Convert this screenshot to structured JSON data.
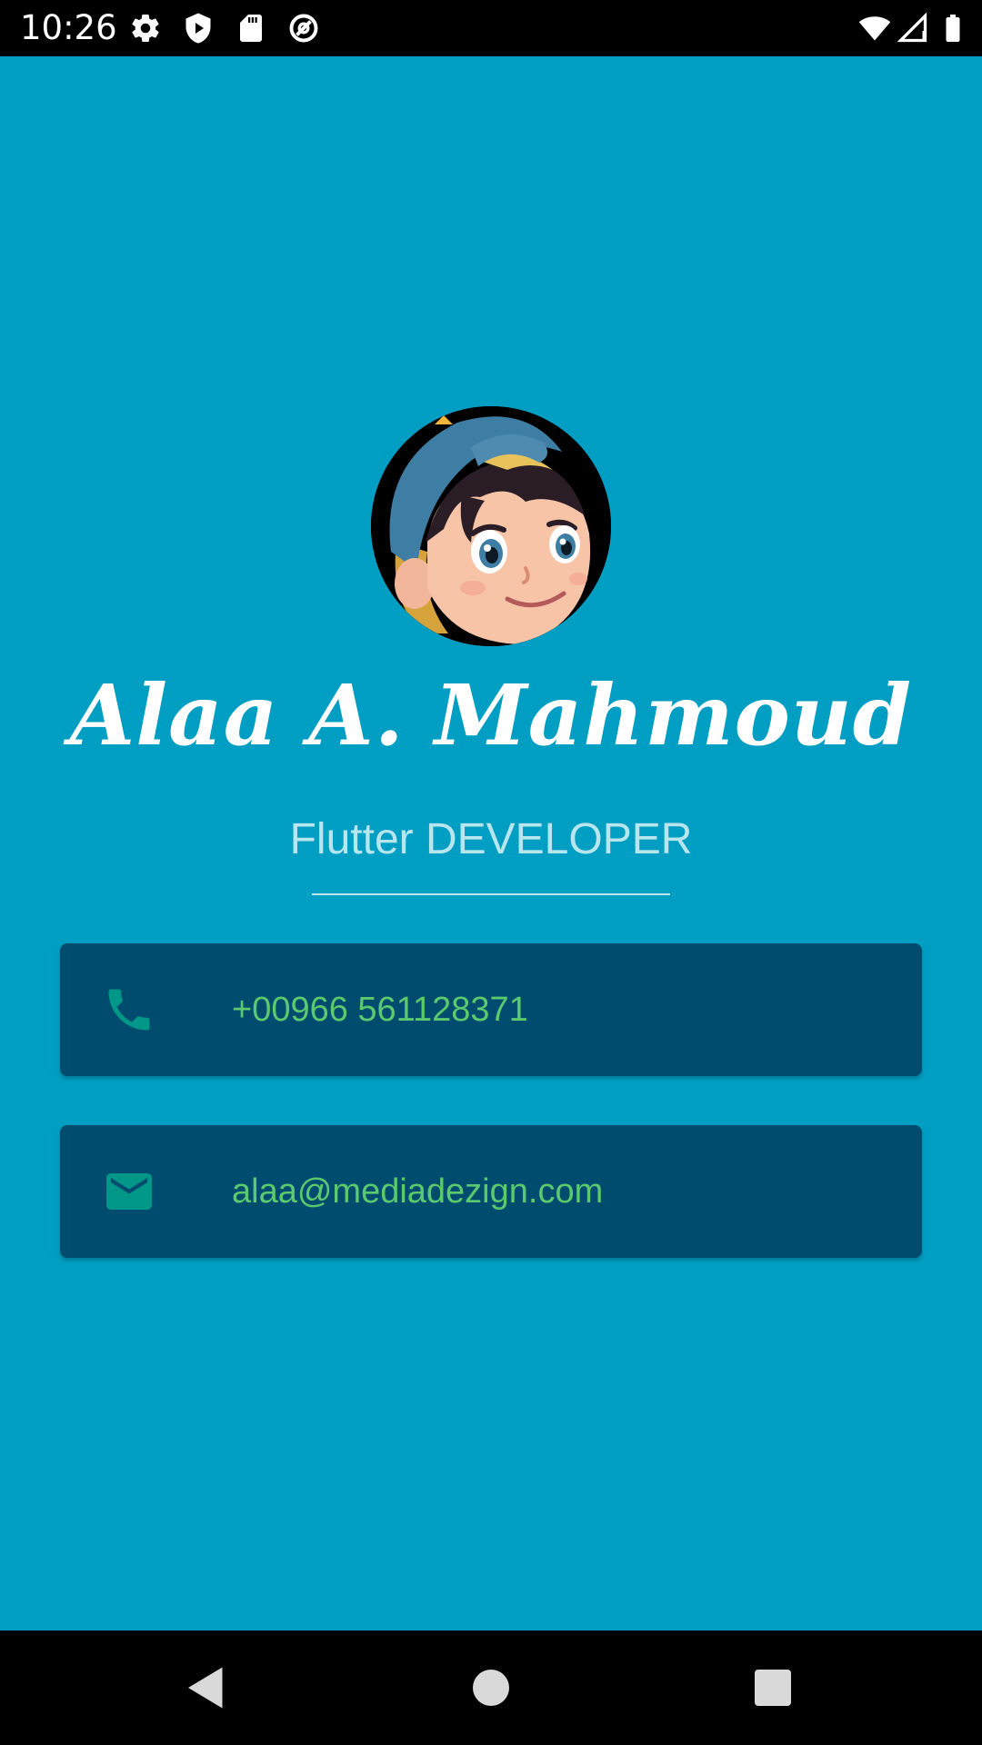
{
  "status_bar": {
    "time": "10:26",
    "icons": [
      "settings-icon",
      "shield-play-icon",
      "sd-card-icon",
      "data-saver-icon",
      "wifi-icon",
      "signal-icon",
      "battery-icon"
    ]
  },
  "profile": {
    "name": "Alaa A. Mahmoud",
    "title": "Flutter DEVELOPER",
    "avatar": "cartoon-boy-avatar"
  },
  "contacts": {
    "phone": {
      "icon": "phone-icon",
      "value": "+00966 561128371"
    },
    "email": {
      "icon": "mail-icon",
      "value": "alaa@mediadezign.com"
    }
  },
  "nav_bar": {
    "buttons": [
      "back-icon",
      "home-icon",
      "recents-icon"
    ]
  },
  "colors": {
    "background": "#009ec2",
    "card": "#004c6f",
    "accent_text": "#5bc96e",
    "icon_teal": "#009688",
    "title_text": "#b7e6ee"
  }
}
